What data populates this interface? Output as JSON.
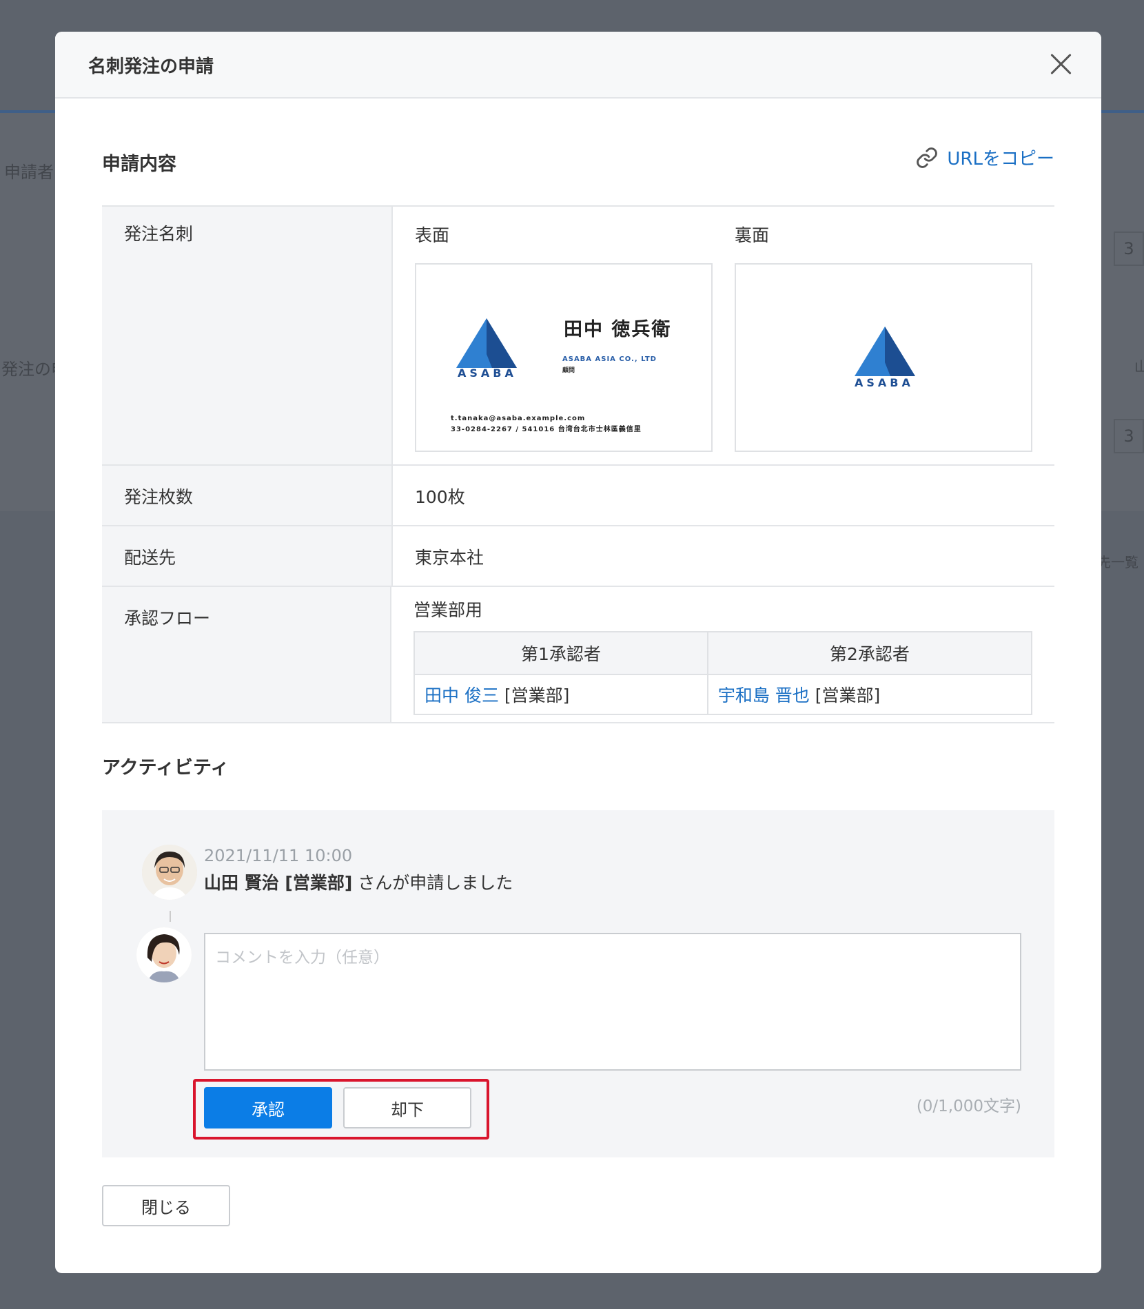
{
  "background": {
    "applicant_label": "申請者",
    "order_label": "発注の申",
    "page_num": "3",
    "list_label": "先一覧",
    "edge_char": "山"
  },
  "modal": {
    "title": "名刺発注の申請",
    "section_request": "申請内容",
    "copy_url": "URLをコピー",
    "rows": {
      "card_label": "発注名刺",
      "front_label": "表面",
      "back_label": "裏面",
      "quantity_label": "発注枚数",
      "quantity_value": "100枚",
      "destination_label": "配送先",
      "destination_value": "東京本社",
      "flow_label": "承認フロー",
      "flow_name": "営業部用"
    },
    "flow": {
      "headers": [
        "第1承認者",
        "第2承認者"
      ],
      "approvers": [
        {
          "name": "田中 俊三",
          "dept": "[営業部]"
        },
        {
          "name": "宇和島 晋也",
          "dept": "[営業部]"
        }
      ]
    },
    "card_front": {
      "brand": "ASABA",
      "name": "田中 徳兵衛",
      "company": "ASABA ASIA CO., LTD",
      "role": "顧問",
      "email": "t.tanaka@asaba.example.com",
      "address": "33-0284-2267 / 541016 台湾台北市士林區義信里"
    },
    "card_back": {
      "brand": "ASABA"
    },
    "section_activity": "アクティビティ",
    "activity": {
      "timestamp": "2021/11/11 10:00",
      "actor": "山田 賢治 [営業部]",
      "action": " さんが申請しました",
      "comment_placeholder": "コメントを入力（任意）",
      "counter": "(0/1,000文字)",
      "approve_label": "承認",
      "reject_label": "却下"
    },
    "close_label": "閉じる"
  },
  "colors": {
    "primary": "#0b7de6",
    "link": "#1a6fc4",
    "highlight": "#d9152d",
    "brand_blue": "#1f4f94"
  }
}
